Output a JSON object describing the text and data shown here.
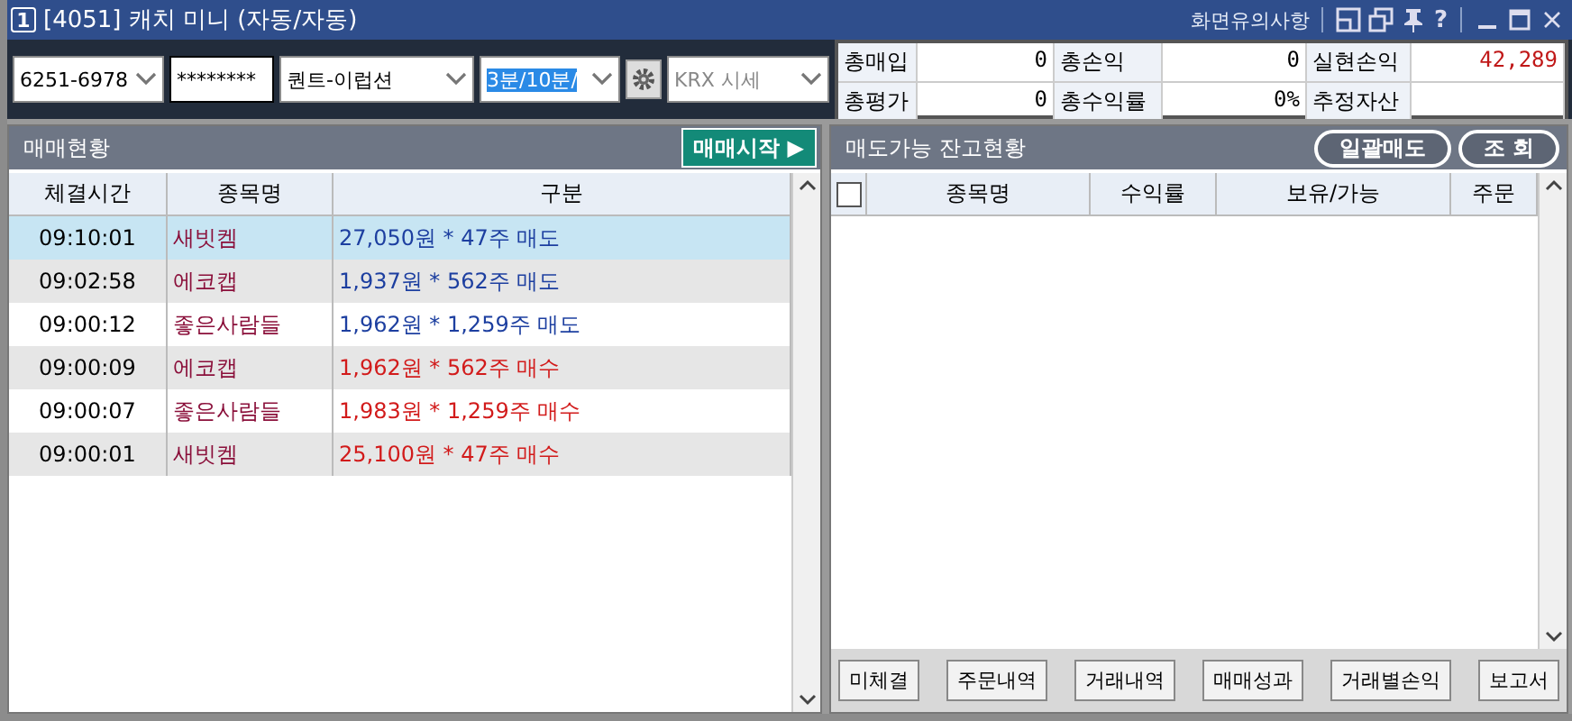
{
  "window": {
    "badge": "1",
    "title": "[4051] 캐치 미니 (자동/자동)",
    "notice_link": "화면유의사항",
    "help": "?"
  },
  "toolbar": {
    "account": "6251-6978",
    "password": "********",
    "strategy": "퀀트-이럽션",
    "interval": "3분/10분/",
    "interval_selected": true,
    "market": "KRX 시세",
    "market_disabled": true
  },
  "summary": [
    {
      "label": "총매입",
      "value": "0",
      "kind": "plain"
    },
    {
      "label": "총손익",
      "value": "0",
      "kind": "plain"
    },
    {
      "label": "실현손익",
      "value": "42,289",
      "kind": "gain"
    },
    {
      "label": "총평가",
      "value": "0",
      "kind": "plain"
    },
    {
      "label": "총수익률",
      "value": "0%",
      "kind": "plain"
    },
    {
      "label": "추정자산",
      "kind": "plain"
    }
  ],
  "trades_panel": {
    "title": "매매현황",
    "start_button": "매매시작 ▶",
    "columns": [
      "체결시간",
      "종목명",
      "구분"
    ],
    "rows": [
      {
        "time": "09:10:01",
        "name": "새빗켐",
        "detail": "27,050원 * 47주 매도",
        "kind": "sell",
        "selected": true
      },
      {
        "time": "09:02:58",
        "name": "에코캡",
        "detail": "1,937원 * 562주 매도",
        "kind": "sell",
        "selected": false
      },
      {
        "time": "09:00:12",
        "name": "좋은사람들",
        "detail": "1,962원 * 1,259주 매도",
        "kind": "sell",
        "selected": false
      },
      {
        "time": "09:00:09",
        "name": "에코캡",
        "detail": "1,962원 * 562주 매수",
        "kind": "buy",
        "selected": false
      },
      {
        "time": "09:00:07",
        "name": "좋은사람들",
        "detail": "1,983원 * 1,259주 매수",
        "kind": "buy",
        "selected": false
      },
      {
        "time": "09:00:01",
        "name": "새빗켐",
        "detail": "25,100원 * 47주 매수",
        "kind": "buy",
        "selected": false
      }
    ]
  },
  "holdings_panel": {
    "title": "매도가능 잔고현황",
    "buttons": [
      "일괄매도",
      "조 회"
    ],
    "select_all_checked": false,
    "columns": [
      "종목명",
      "수익률",
      "보유/가능",
      "주문"
    ],
    "footer_buttons": [
      "미체결",
      "주문내역",
      "거래내역",
      "매매성과",
      "거래별손익",
      "보고서"
    ]
  }
}
